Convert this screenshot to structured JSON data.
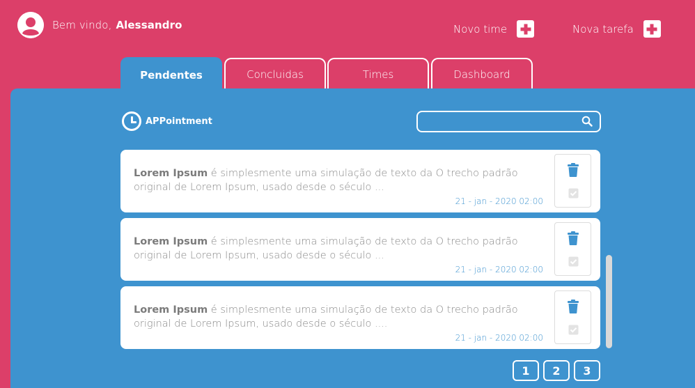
{
  "header": {
    "greeting": "Bem vindo,",
    "user_name": "Alessandro",
    "new_team_label": "Novo time",
    "new_task_label": "Nova tarefa"
  },
  "tabs": [
    {
      "label": "Pendentes",
      "active": true
    },
    {
      "label": "Concluidas",
      "active": false
    },
    {
      "label": "Times",
      "active": false
    },
    {
      "label": "Dashboard",
      "active": false
    }
  ],
  "app": {
    "logo_text": "APPointment",
    "search_placeholder": ""
  },
  "tasks": [
    {
      "title": "Lorem Ipsum",
      "body": " é simplesmente uma simulação de texto da O trecho padrão original de Lorem Ipsum, usado desde o século ...",
      "date": "21 - jan - 2020 02:00"
    },
    {
      "title": "Lorem Ipsum",
      "body": " é simplesmente uma simulação de texto da O trecho padrão original de Lorem Ipsum, usado desde o século ...",
      "date": "21 - jan - 2020 02:00"
    },
    {
      "title": "Lorem Ipsum",
      "body": " é simplesmente uma simulação de texto da O trecho padrão original de Lorem Ipsum, usado desde o século ....",
      "date": "21 - jan - 2020 02:00"
    }
  ],
  "pagination": [
    "1",
    "2",
    "3"
  ],
  "colors": {
    "header_bg": "#dc3f69",
    "panel_bg": "#3e93cf",
    "card_bg": "#ffffff",
    "date_text": "#3e93cf"
  },
  "icons": {
    "avatar": "user-avatar-icon",
    "add": "plus-icon",
    "logo": "clock-icon",
    "search": "search-icon",
    "delete": "trash-icon",
    "complete": "checkbox-icon"
  }
}
